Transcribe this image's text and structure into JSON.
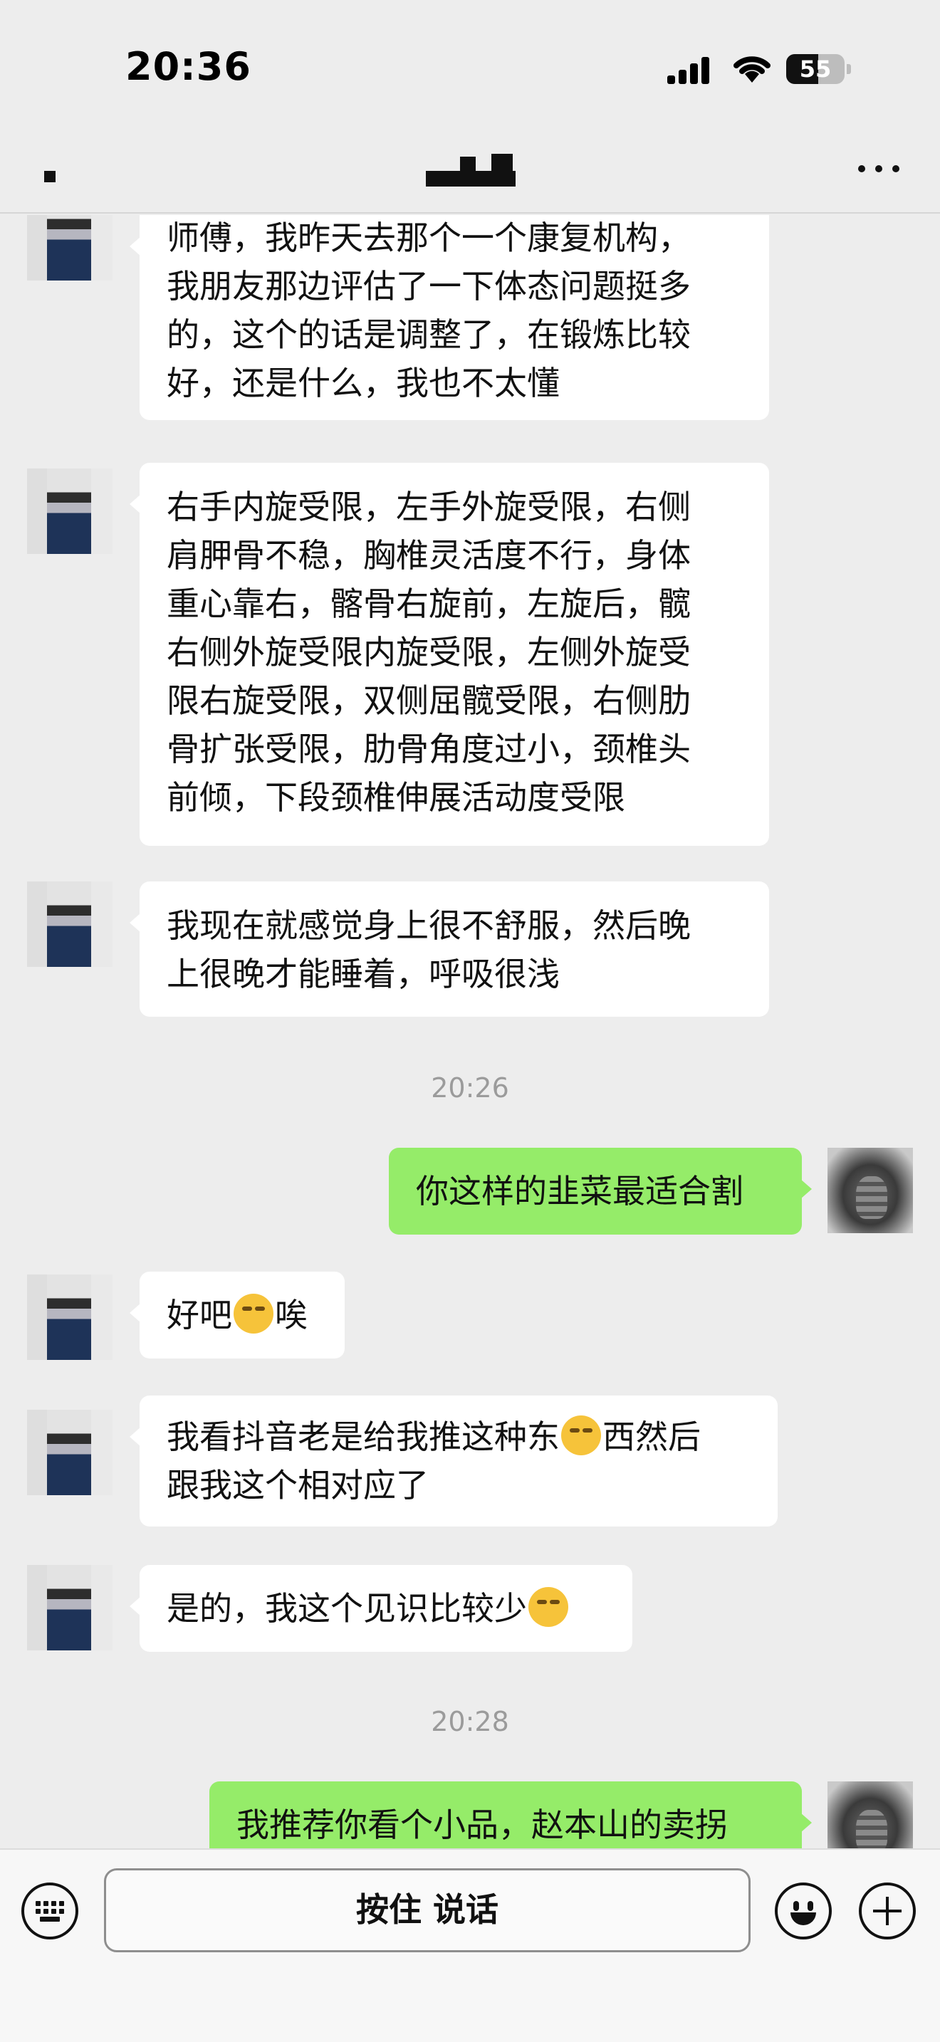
{
  "status_bar": {
    "time": "20:36",
    "battery_level": "55",
    "icons": [
      "cellular-signal-icon",
      "wifi-icon",
      "battery-icon"
    ]
  },
  "nav": {
    "icons": [
      "back-icon",
      "more-icon"
    ]
  },
  "messages": [
    {
      "sender": "other",
      "text": "师傅，我昨天去那个一个康复机构，\n我朋友那边评估了一下体态问题挺多\n的，这个的话是调整了，在锻炼比较\n好，还是什么，我也不太懂"
    },
    {
      "sender": "other",
      "text": "右手内旋受限，左手外旋受限，右侧\n肩胛骨不稳，胸椎灵活度不行，身体\n重心靠右，髂骨右旋前，左旋后，髋\n右侧外旋受限内旋受限，左侧外旋受\n限右旋受限，双侧屈髋受限，右侧肋\n骨扩张受限，肋骨角度过小，颈椎头\n前倾，下段颈椎伸展活动度受限"
    },
    {
      "sender": "other",
      "text": "我现在就感觉身上很不舒服，然后晚\n上很晚才能睡着，呼吸很浅"
    },
    {
      "type": "timestamp",
      "text": "20:26"
    },
    {
      "sender": "self",
      "text": "你这样的韭菜最适合割"
    },
    {
      "sender": "other",
      "text_before": "好吧",
      "emoji": "crying-laughing-emoji",
      "text_after": "唉"
    },
    {
      "sender": "other",
      "text_before": "我看抖音老是给我推这种东",
      "emoji": "dizzy-face-emoji",
      "text_after": "西然后\n跟我这个相对应了"
    },
    {
      "sender": "other",
      "text_before": "是的，我这个见识比较少",
      "emoji": "crying-laughing-emoji",
      "text_after": ""
    },
    {
      "type": "timestamp",
      "text": "20:28"
    },
    {
      "sender": "self",
      "text": "我推荐你看个小品，赵本山的卖拐"
    }
  ],
  "input_bar": {
    "hold_to_talk_label": "按住 说话",
    "icons": [
      "keyboard-icon",
      "emoji-icon",
      "plus-icon"
    ]
  }
}
